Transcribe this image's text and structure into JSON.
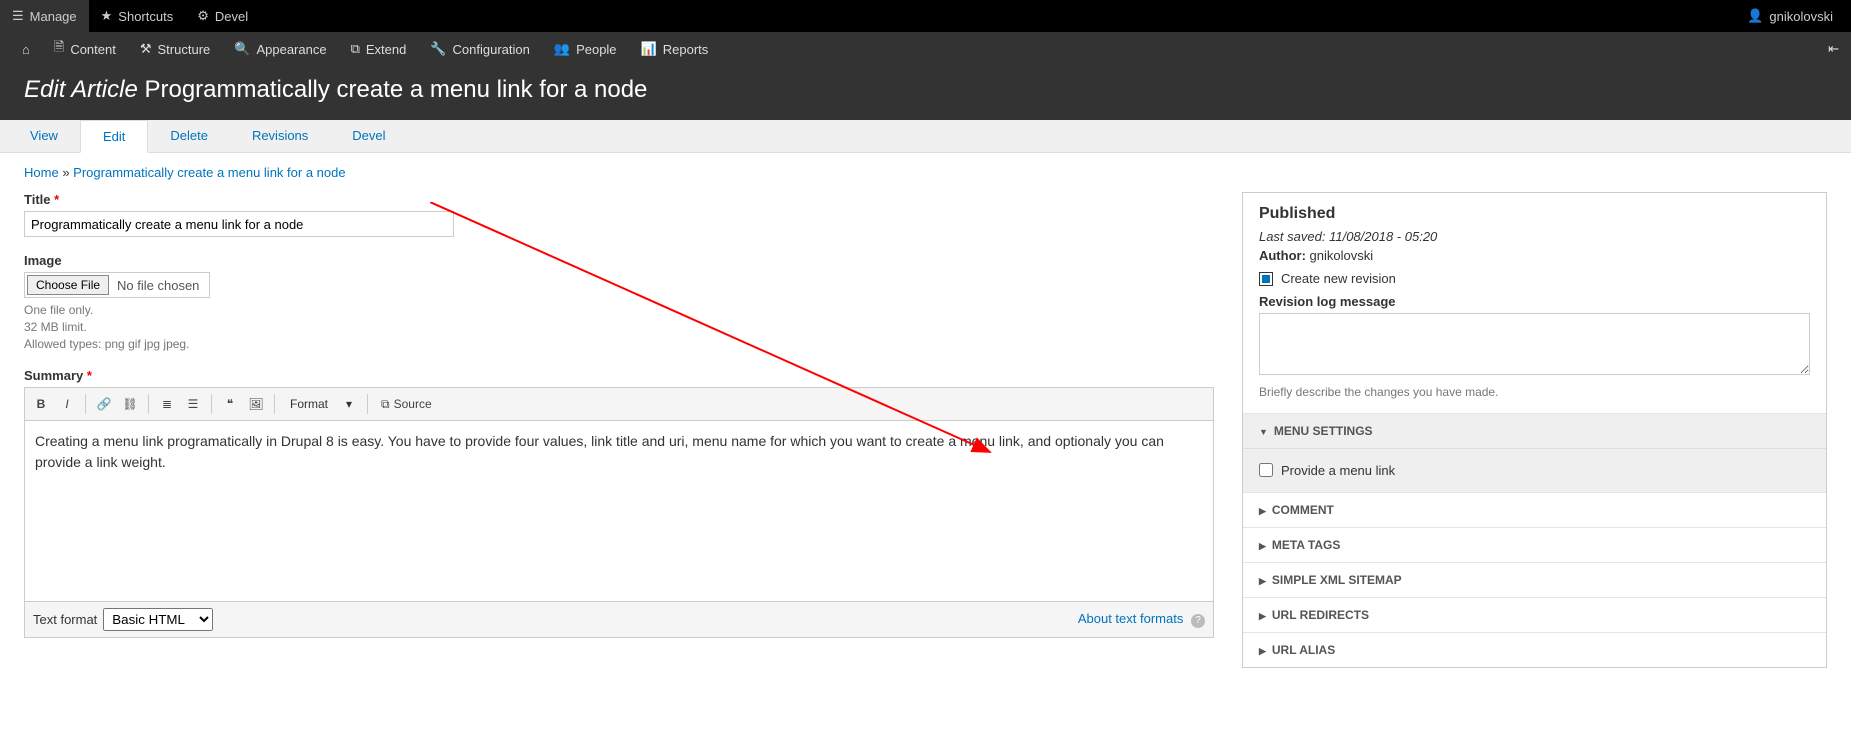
{
  "toolbar_top": {
    "manage": "Manage",
    "shortcuts": "Shortcuts",
    "devel": "Devel",
    "user": "gnikolovski"
  },
  "toolbar_sec": {
    "content": "Content",
    "structure": "Structure",
    "appearance": "Appearance",
    "extend": "Extend",
    "configuration": "Configuration",
    "people": "People",
    "reports": "Reports"
  },
  "page_title": {
    "prefix": "Edit Article",
    "title": "Programmatically create a menu link for a node"
  },
  "tabs": {
    "view": "View",
    "edit": "Edit",
    "delete": "Delete",
    "revisions": "Revisions",
    "devel": "Devel"
  },
  "breadcrumb": {
    "home": "Home",
    "sep": "»",
    "current": "Programmatically create a menu link for a node"
  },
  "form": {
    "title_label": "Title",
    "title_value": "Programmatically create a menu link for a node",
    "image_label": "Image",
    "choose_file": "Choose File",
    "no_file": "No file chosen",
    "desc1": "One file only.",
    "desc2": "32 MB limit.",
    "desc3": "Allowed types: png gif jpg jpeg.",
    "summary_label": "Summary",
    "summary_body": "Creating a menu link programatically in Drupal 8 is easy. You have to provide four values, link title and uri, menu name for which you want to create a menu link, and optionaly you can provide a link weight.",
    "format_label": "Format",
    "source_label": "Source",
    "text_format_label": "Text format",
    "text_format_value": "Basic HTML",
    "about_formats": "About text formats"
  },
  "sidebar": {
    "published": "Published",
    "last_saved_label": "Last saved:",
    "last_saved_value": "11/08/2018 - 05:20",
    "author_label": "Author:",
    "author_value": "gnikolovski",
    "create_revision": "Create new revision",
    "revision_log_label": "Revision log message",
    "revision_desc": "Briefly describe the changes you have made.",
    "menu_settings": "MENU SETTINGS",
    "provide_menu_link": "Provide a menu link",
    "comment": "COMMENT",
    "meta_tags": "META TAGS",
    "xml_sitemap": "SIMPLE XML SITEMAP",
    "url_redirects": "URL REDIRECTS",
    "url_alias": "URL ALIAS"
  }
}
